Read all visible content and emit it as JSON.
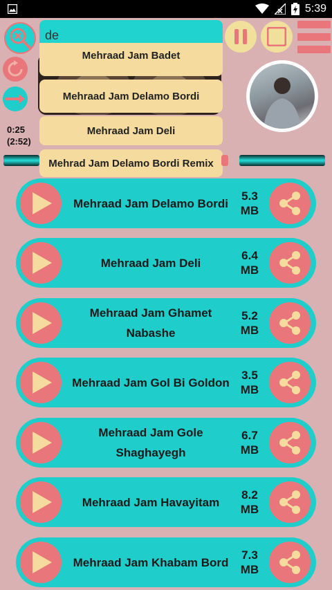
{
  "status_bar": {
    "time": "5:39",
    "icons": [
      "image-icon",
      "wifi-icon",
      "signal-icon",
      "battery-charging-icon"
    ]
  },
  "search": {
    "value": "de",
    "placeholder": ""
  },
  "player": {
    "current_time": "0:25",
    "total_time": "(2:52)",
    "controls": [
      "pause-icon",
      "stop-icon",
      "menu-icon",
      "repeat-icon",
      "shuffle-icon",
      "clear-search-icon"
    ]
  },
  "suggestions": [
    "Mehraad Jam Badet",
    "Mehraad Jam Delamo Bordi",
    "Mehraad Jam Deli",
    "Mehrad Jam Delamo Bordi Remix"
  ],
  "songs": [
    {
      "title": "Mehraad Jam Delamo Bordi",
      "size": "5.3 MB"
    },
    {
      "title": "Mehraad Jam Deli",
      "size": "6.4 MB"
    },
    {
      "title": "Mehraad Jam Ghamet Nabashe",
      "size": "5.2 MB"
    },
    {
      "title": "Mehraad Jam Gol Bi Goldon",
      "size": "3.5 MB"
    },
    {
      "title": "Mehraad Jam Gole Shaghayegh",
      "size": "6.7 MB"
    },
    {
      "title": "Mehraad Jam Havayitam",
      "size": "8.2 MB"
    },
    {
      "title": "Mehraad Jam Khabam Bord",
      "size": "7.3 MB"
    }
  ],
  "colors": {
    "background": "#d9b1b2",
    "accent_teal": "#1fcdca",
    "accent_coral": "#e8767a",
    "accent_yellow": "#f5dc9e"
  }
}
